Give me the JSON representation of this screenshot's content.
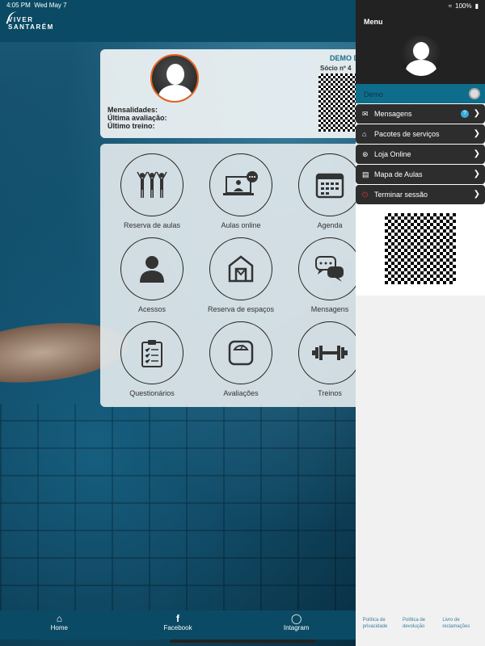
{
  "status": {
    "time": "4:05 PM",
    "date": "Wed May 7",
    "battery": "100%"
  },
  "brand": {
    "line1": "VIVER",
    "line2": "SANTARÉM"
  },
  "profile": {
    "name": "DEMO D",
    "member": "Sócio nº 4",
    "fields": [
      "Mensalidades:",
      "Última avaliação:",
      "Último treino:"
    ]
  },
  "tiles": [
    {
      "label": "Reserva de aulas",
      "icon": "group-fitness-icon"
    },
    {
      "label": "Aulas online",
      "icon": "online-class-icon"
    },
    {
      "label": "Agenda",
      "icon": "calendar-icon"
    },
    {
      "label": "Acessos",
      "icon": "person-icon"
    },
    {
      "label": "Reserva de espaços",
      "icon": "building-icon"
    },
    {
      "label": "Mensagens",
      "icon": "chat-icon"
    },
    {
      "label": "Questionários",
      "icon": "clipboard-icon"
    },
    {
      "label": "Avaliações",
      "icon": "scale-icon"
    },
    {
      "label": "Treinos",
      "icon": "dumbbell-icon"
    }
  ],
  "menu": {
    "title": "Menu",
    "user": "Demo",
    "items": [
      {
        "label": "Mensagens",
        "icon": "envelope-icon",
        "badge": "?"
      },
      {
        "label": "Pacotes de serviços",
        "icon": "institution-icon"
      },
      {
        "label": "Loja Online",
        "icon": "cart-icon"
      },
      {
        "label": "Mapa de Aulas",
        "icon": "map-icon"
      },
      {
        "label": "Terminar sessão",
        "icon": "power-icon"
      }
    ],
    "footer": [
      "Política de privacidade",
      "Política de devolução",
      "Livro de reclamações"
    ]
  },
  "bottom_nav": [
    {
      "label": "Home",
      "icon": "home-icon"
    },
    {
      "label": "Facebook",
      "icon": "facebook-icon"
    },
    {
      "label": "Intagram",
      "icon": "instagram-icon"
    }
  ],
  "colors": {
    "header": "#0a4a64",
    "accent_orange": "#e4631f",
    "menu_dark": "#2d2d2d",
    "user_row": "#0f6d8c"
  }
}
